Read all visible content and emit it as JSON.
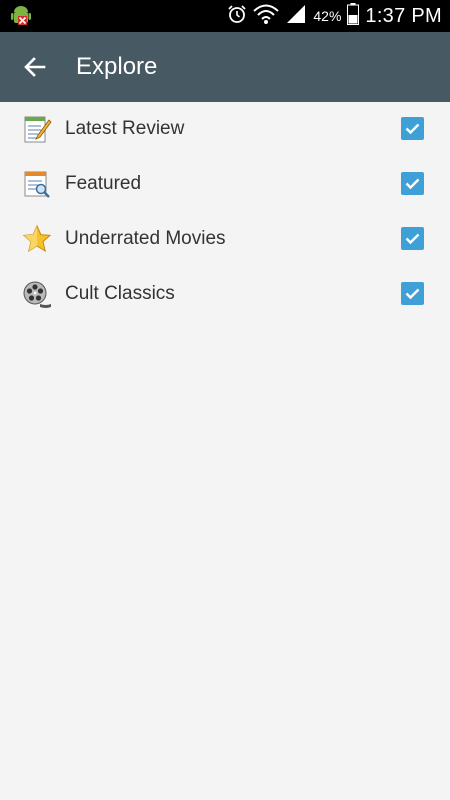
{
  "status_bar": {
    "battery_percent": "42%",
    "time": "1:37 PM",
    "icons": [
      "android-debug-icon",
      "alarm-icon",
      "wifi-icon",
      "signal-icon",
      "battery-icon"
    ]
  },
  "action_bar": {
    "title": "Explore",
    "back_icon": "arrow-left-icon",
    "background": "#475a63"
  },
  "items": [
    {
      "label": "Latest Review",
      "icon": "notepad-pencil-icon",
      "checked": true
    },
    {
      "label": "Featured",
      "icon": "document-search-icon",
      "checked": true
    },
    {
      "label": "Underrated Movies",
      "icon": "star-icon",
      "checked": true
    },
    {
      "label": "Cult Classics",
      "icon": "film-reel-icon",
      "checked": true
    }
  ],
  "colors": {
    "checkbox": "#3fa0d8",
    "background": "#f4f4f4"
  }
}
